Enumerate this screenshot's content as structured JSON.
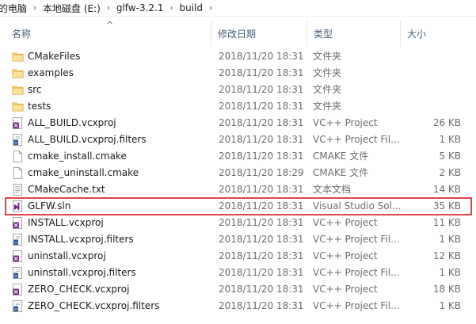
{
  "breadcrumb": [
    "的电脑",
    "本地磁盘 (E:)",
    "glfw-3.2.1",
    "build"
  ],
  "columns": {
    "name": "名称",
    "date": "修改日期",
    "type": "类型",
    "size": "大小"
  },
  "files": [
    {
      "name": "CMakeFiles",
      "date": "2018/11/20 18:31",
      "type": "文件夹",
      "size": "",
      "icon": "folder-icon"
    },
    {
      "name": "examples",
      "date": "2018/11/20 18:31",
      "type": "文件夹",
      "size": "",
      "icon": "folder-icon"
    },
    {
      "name": "src",
      "date": "2018/11/20 18:31",
      "type": "文件夹",
      "size": "",
      "icon": "folder-icon"
    },
    {
      "name": "tests",
      "date": "2018/11/20 18:31",
      "type": "文件夹",
      "size": "",
      "icon": "folder-icon"
    },
    {
      "name": "ALL_BUILD.vcxproj",
      "date": "2018/11/20 18:31",
      "type": "VC++ Project",
      "size": "26 KB",
      "icon": "vcxproj-icon"
    },
    {
      "name": "ALL_BUILD.vcxproj.filters",
      "date": "2018/11/20 18:31",
      "type": "VC++ Project Fil...",
      "size": "1 KB",
      "icon": "filters-icon"
    },
    {
      "name": "cmake_install.cmake",
      "date": "2018/11/20 18:31",
      "type": "CMAKE 文件",
      "size": "5 KB",
      "icon": "file-icon"
    },
    {
      "name": "cmake_uninstall.cmake",
      "date": "2018/11/20 18:29",
      "type": "CMAKE 文件",
      "size": "2 KB",
      "icon": "file-icon"
    },
    {
      "name": "CMakeCache.txt",
      "date": "2018/11/20 18:31",
      "type": "文本文档",
      "size": "14 KB",
      "icon": "text-file-icon"
    },
    {
      "name": "GLFW.sln",
      "date": "2018/11/20 18:31",
      "type": "Visual Studio Sol...",
      "size": "35 KB",
      "icon": "sln-icon",
      "selected": true
    },
    {
      "name": "INSTALL.vcxproj",
      "date": "2018/11/20 18:31",
      "type": "VC++ Project",
      "size": "11 KB",
      "icon": "vcxproj-icon"
    },
    {
      "name": "INSTALL.vcxproj.filters",
      "date": "2018/11/20 18:31",
      "type": "VC++ Project Fil...",
      "size": "1 KB",
      "icon": "filters-icon"
    },
    {
      "name": "uninstall.vcxproj",
      "date": "2018/11/20 18:31",
      "type": "VC++ Project",
      "size": "12 KB",
      "icon": "vcxproj-icon"
    },
    {
      "name": "uninstall.vcxproj.filters",
      "date": "2018/11/20 18:31",
      "type": "VC++ Project Fil...",
      "size": "1 KB",
      "icon": "filters-icon"
    },
    {
      "name": "ZERO_CHECK.vcxproj",
      "date": "2018/11/20 18:31",
      "type": "VC++ Project",
      "size": "18 KB",
      "icon": "vcxproj-icon"
    },
    {
      "name": "ZERO_CHECK.vcxproj.filters",
      "date": "2018/11/20 18:31",
      "type": "VC++ Project Fil...",
      "size": "1 KB",
      "icon": "filters-icon"
    }
  ],
  "colors": {
    "folder": "#f8d775",
    "vcxproj": "#68217a",
    "selection_border": "#e04444"
  }
}
